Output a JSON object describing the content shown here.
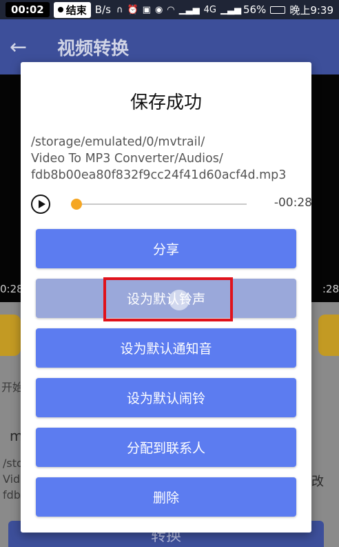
{
  "status_bar": {
    "record_time": "00:02",
    "record_end_label": "结束",
    "net_speed": "B/s",
    "signal_type": "4G",
    "battery": "56%",
    "time": "晚上9:39"
  },
  "app_bar": {
    "title": "视频转换"
  },
  "background": {
    "time_left": "0:28",
    "time_right": ":28",
    "label_start": "开始",
    "field_value": "m",
    "path_line1": "/sto",
    "path_line2": "Vid",
    "path_line3": "fdb",
    "right_label": "改",
    "convert_button": "转换"
  },
  "dialog": {
    "title": "保存成功",
    "path_lines": [
      "/storage/emulated/0/mvtrail/",
      "Video To MP3 Converter/Audios/",
      "fdb8b00ea80f832f9cc24f41d60acf4d.mp3"
    ],
    "player": {
      "remaining": "-00:28",
      "progress": 0.03
    },
    "actions": [
      {
        "label": "分享"
      },
      {
        "label": "设为默认铃声"
      },
      {
        "label": "设为默认通知音"
      },
      {
        "label": "设为默认闹铃"
      },
      {
        "label": "分配到联系人"
      },
      {
        "label": "删除"
      }
    ]
  },
  "colors": {
    "accent": "#5c7cf0",
    "pressed": "#9aa8da",
    "seek": "#f5a623",
    "highlight": "#e0121b"
  }
}
